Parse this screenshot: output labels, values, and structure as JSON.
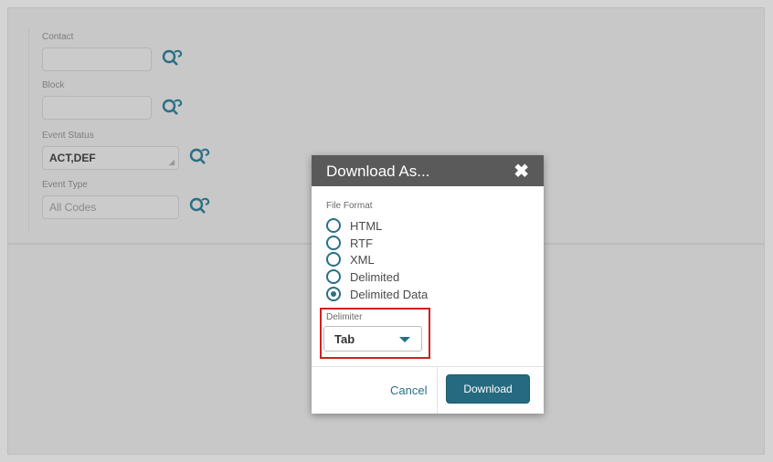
{
  "form": {
    "fields": [
      {
        "label": "Contact",
        "value": "",
        "placeholder": ""
      },
      {
        "label": "Block",
        "value": "",
        "placeholder": ""
      },
      {
        "label": "Event Status",
        "value": "ACT,DEF",
        "placeholder": ""
      },
      {
        "label": "Event Type",
        "value": "",
        "placeholder": "All Codes"
      }
    ],
    "lookup_icon": "search-lookup-icon"
  },
  "dialog": {
    "title": "Download As...",
    "close_icon": "close-icon",
    "file_format_label": "File Format",
    "options": [
      {
        "label": "HTML",
        "checked": false
      },
      {
        "label": "RTF",
        "checked": false
      },
      {
        "label": "XML",
        "checked": false
      },
      {
        "label": "Delimited",
        "checked": false
      },
      {
        "label": "Delimited Data",
        "checked": true
      }
    ],
    "delimiter_label": "Delimiter",
    "delimiter_value": "Tab",
    "cancel_label": "Cancel",
    "download_label": "Download"
  },
  "colors": {
    "accent": "#266a80",
    "header": "#5a5a5a",
    "highlight": "#d21f1f"
  }
}
